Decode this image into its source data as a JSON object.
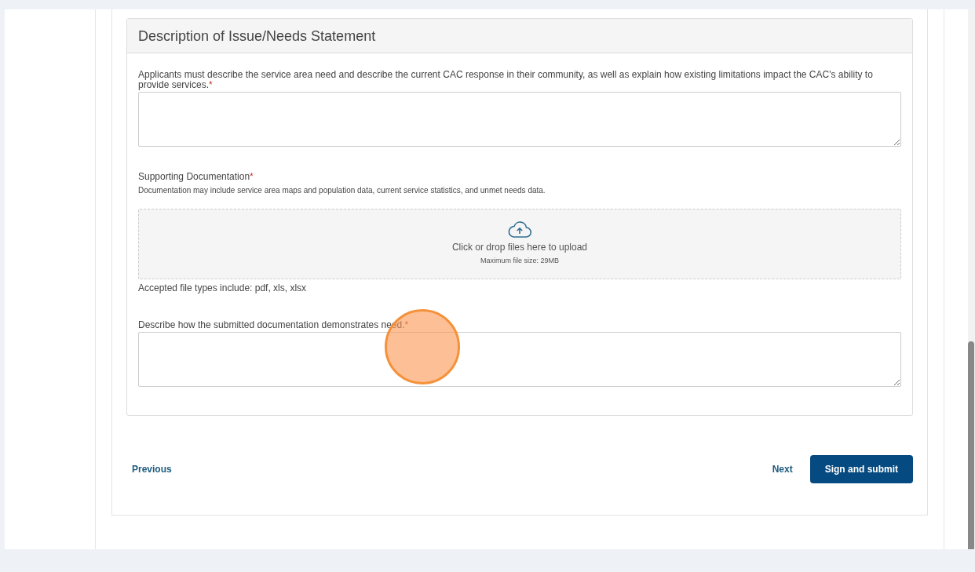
{
  "section": {
    "title": "Description of Issue/Needs Statement",
    "fields": [
      {
        "kind": "textarea",
        "label": "Applicants must describe the service area need and describe the current CAC response in their community, as well as explain how existing limitations impact the CAC's ability to provide services.",
        "required_mark": "*"
      },
      {
        "kind": "upload",
        "label": "Supporting Documentation",
        "required_mark": "*",
        "help": "Documentation may include service area maps and population data, current service statistics, and unmet needs data.",
        "drop_text": "Click or drop files here to upload",
        "max_size": "Maximum file size: 29MB",
        "accepted": "Accepted file types include: pdf, xls, xlsx"
      },
      {
        "kind": "textarea",
        "label": "Describe how the submitted documentation demonstrates need.",
        "required_mark": "*"
      }
    ]
  },
  "navigation": {
    "previous": "Previous",
    "next": "Next",
    "submit": "Sign and submit"
  },
  "click_indicator": {
    "shown": true
  }
}
